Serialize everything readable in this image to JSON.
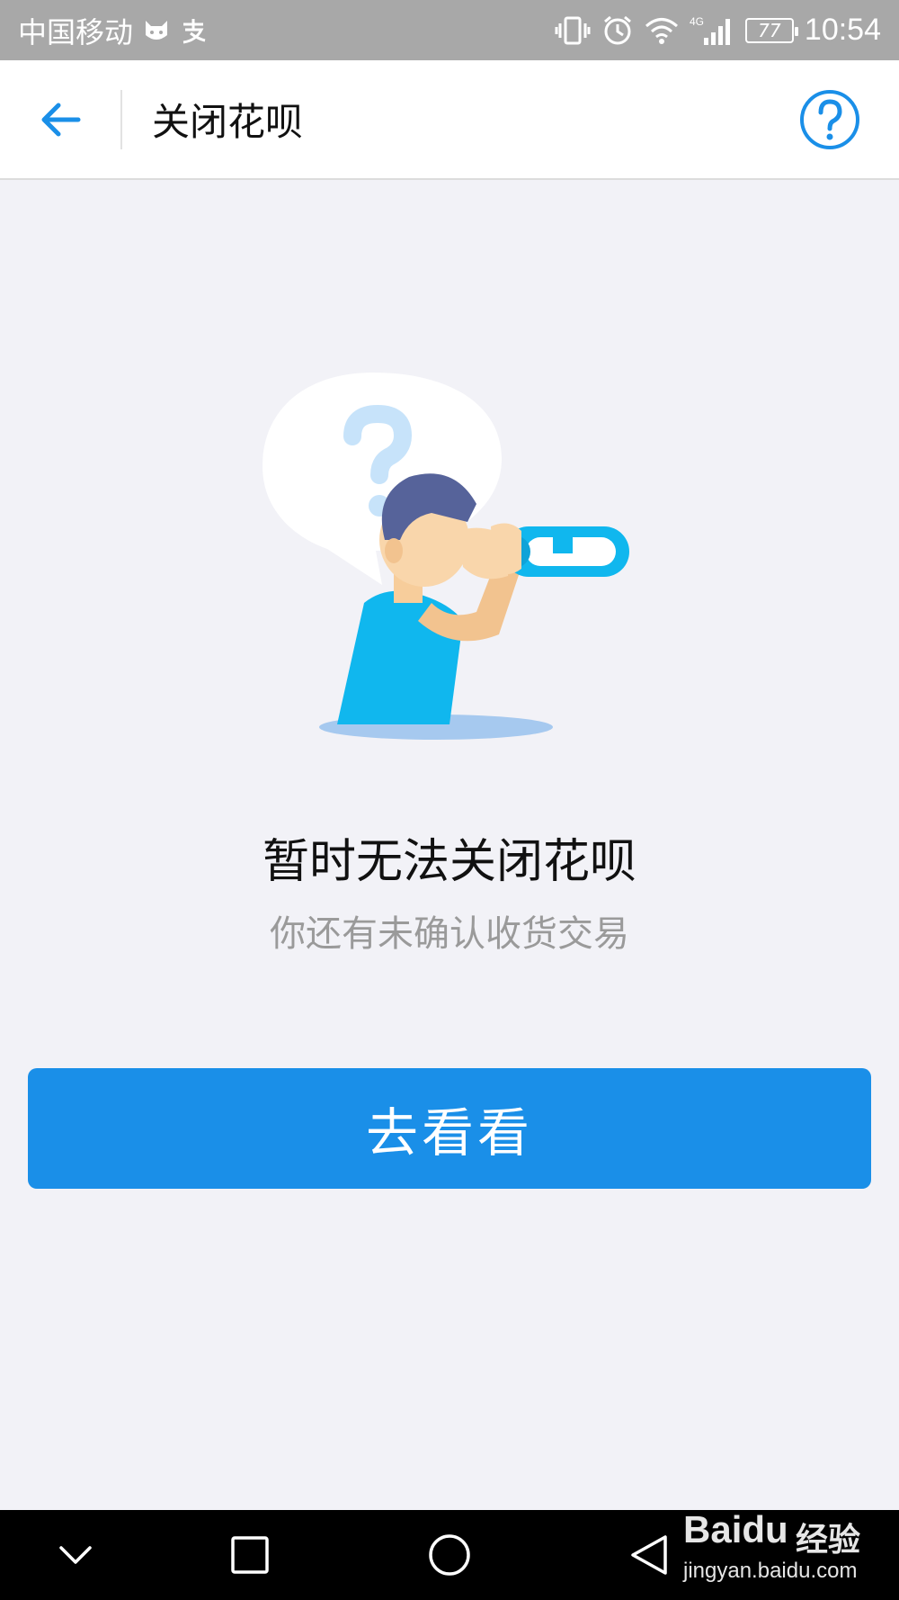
{
  "status_bar": {
    "carrier": "中国移动",
    "network": "4G",
    "battery": "77",
    "time": "10:54",
    "icons": [
      "cat-app-icon",
      "alipay-icon",
      "vibrate-icon",
      "alarm-icon",
      "wifi-icon",
      "signal-icon",
      "battery-icon"
    ]
  },
  "nav": {
    "title": "关闭花呗",
    "back_icon": "back-arrow-icon",
    "help_icon": "help-icon"
  },
  "empty_state": {
    "title": "暂时无法关闭花呗",
    "subtitle": "你还有未确认收货交易"
  },
  "action": {
    "button_label": "去看看"
  },
  "system_nav": {
    "icons": [
      "chevron-down-icon",
      "recent-apps-icon",
      "home-icon",
      "back-icon"
    ]
  },
  "watermark": {
    "brand": "Baidu",
    "cn": "经验",
    "url": "jingyan.baidu.com"
  },
  "colors": {
    "accent": "#1a8fe8",
    "background": "#f2f2f7",
    "status_bar": "#a8a8a8"
  }
}
